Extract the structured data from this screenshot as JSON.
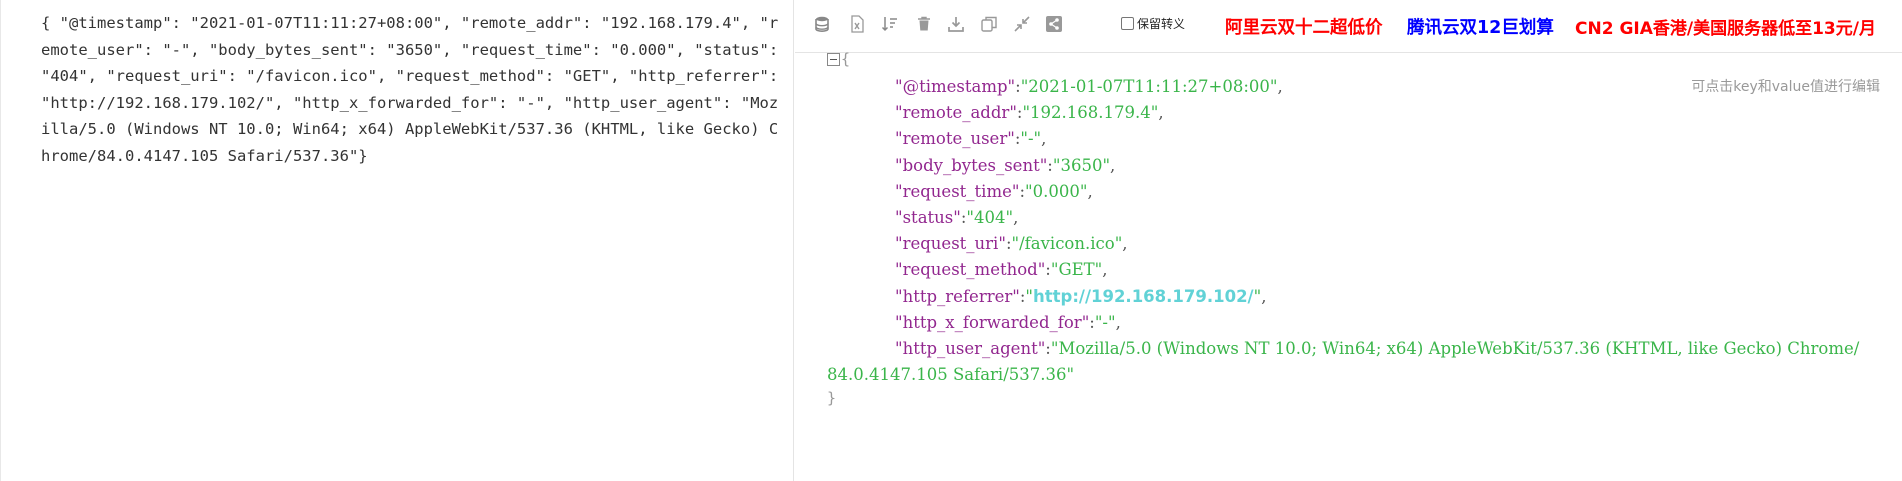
{
  "raw_json_text": "{ \"@timestamp\": \"2021-01-07T11:11:27+08:00\", \"remote_addr\": \"192.168.179.4\", \"remote_user\": \"-\", \"body_bytes_sent\": \"3650\", \"request_time\": \"0.000\", \"status\": \"404\", \"request_uri\": \"/favicon.ico\", \"request_method\": \"GET\", \"http_referrer\": \"http://192.168.179.102/\", \"http_x_forwarded_for\": \"-\", \"http_user_agent\": \"Mozilla/5.0 (Windows NT 10.0; Win64; x64) AppleWebKit/537.36 (KHTML, like Gecko) Chrome/84.0.4147.105 Safari/537.36\"}",
  "toolbar": {
    "icons": [
      "database-icon",
      "excel-icon",
      "sort-icon",
      "trash-icon",
      "download-icon",
      "copy-icon",
      "compress-icon",
      "share-icon"
    ],
    "keep_escape_label": "保留转义"
  },
  "ads": {
    "aliyun": "阿里云双十二超低价",
    "tencent": "腾讯云双12巨划算",
    "cn2": "CN2 GIA香港/美国服务器低至13元/月"
  },
  "edit_hint": "可点击key和value值进行编辑",
  "tree": {
    "open_brace": "{",
    "close_brace": "}",
    "entries": [
      {
        "key": "\"@timestamp\"",
        "value": "\"2021-01-07T11:11:27+08:00\""
      },
      {
        "key": "\"remote_addr\"",
        "value": "\"192.168.179.4\""
      },
      {
        "key": "\"remote_user\"",
        "value": "\"-\""
      },
      {
        "key": "\"body_bytes_sent\"",
        "value": "\"3650\""
      },
      {
        "key": "\"request_time\"",
        "value": "\"0.000\""
      },
      {
        "key": "\"status\"",
        "value": "\"404\""
      },
      {
        "key": "\"request_uri\"",
        "value": "\"/favicon.ico\""
      },
      {
        "key": "\"request_method\"",
        "value": "\"GET\""
      },
      {
        "key": "\"http_referrer\"",
        "value_q1": "\"",
        "value_link": "http://192.168.179.102/",
        "value_q2": "\""
      },
      {
        "key": "\"http_x_forwarded_for\"",
        "value": "\"-\""
      },
      {
        "key": "\"http_user_agent\"",
        "value": "\"Mozilla/5.0  (Windows  NT  10.0;  Win64;  x64)  AppleWebKit/537.36  (KHTML,  like  Gecko)  Chrome/84.0.4147.105  Safari/537.36\""
      }
    ]
  },
  "colors": {
    "key": "#92278f",
    "string_value": "#3ab54a",
    "link_value": "#61d2d6",
    "ad_red": "#ff0000",
    "ad_blue": "#0000ff"
  }
}
